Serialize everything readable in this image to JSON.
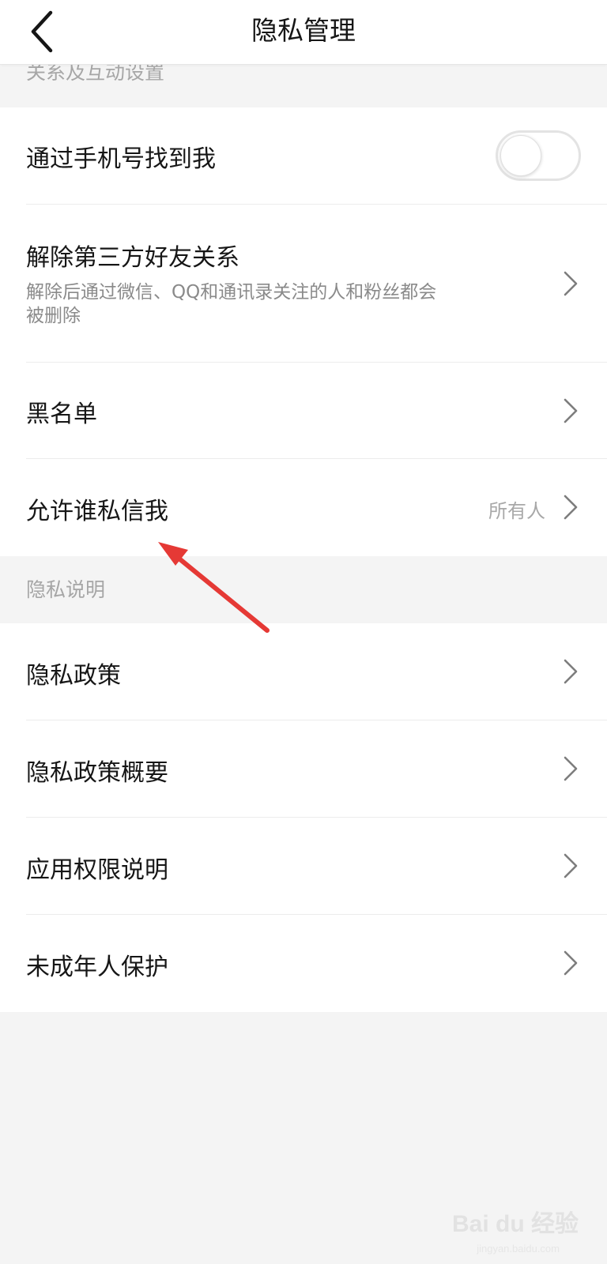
{
  "navbar": {
    "title": "隐私管理"
  },
  "sections": {
    "relations_header": "关系及互动设置",
    "privacy_header": "隐私说明"
  },
  "rows": {
    "find_by_phone": {
      "label": "通过手机号找到我",
      "toggle_on": false
    },
    "remove_third_party": {
      "label": "解除第三方好友关系",
      "subtitle": "解除后通过微信、QQ和通讯录关注的人和粉丝都会被删除"
    },
    "blacklist": {
      "label": "黑名单"
    },
    "who_can_message": {
      "label": "允许谁私信我",
      "value": "所有人"
    },
    "privacy_policy": {
      "label": "隐私政策"
    },
    "privacy_policy_summary": {
      "label": "隐私政策概要"
    },
    "app_permissions": {
      "label": "应用权限说明"
    },
    "minor_protection": {
      "label": "未成年人保护"
    }
  },
  "icons": {
    "back": "back-arrow-icon",
    "chevron": "chevron-right-icon"
  },
  "colors": {
    "background": "#f4f4f4",
    "annotation_arrow": "#e53935"
  },
  "watermark": {
    "text": "Bai du 经验",
    "url": "jingyan.baidu.com"
  }
}
